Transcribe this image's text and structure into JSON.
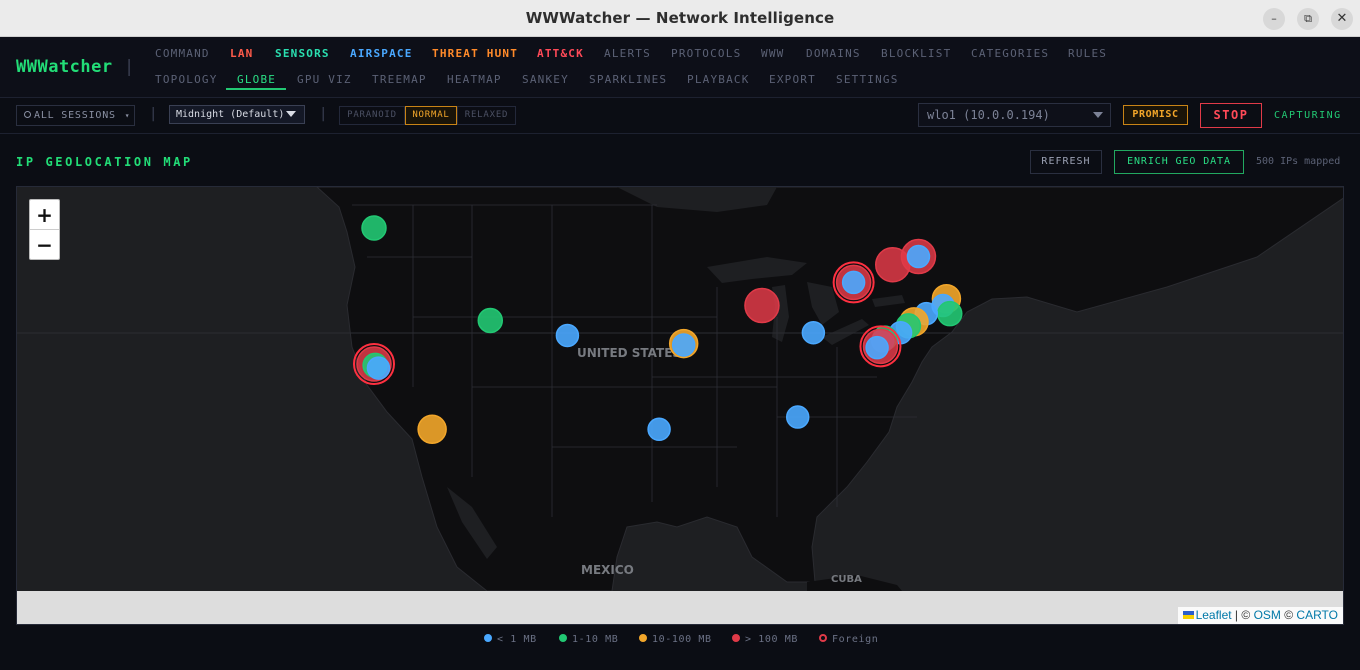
{
  "window": {
    "title": "WWWatcher — Network Intelligence",
    "min_label": "–",
    "max_label": "⧉",
    "close_label": "✕"
  },
  "app": {
    "logo": "WWWatcher",
    "separator": "|"
  },
  "nav": {
    "row1": [
      {
        "label": "COMMAND",
        "color": "#5b6175"
      },
      {
        "label": "LAN",
        "color": "#ff5b4a"
      },
      {
        "label": "SENSORS",
        "color": "#2adfb0"
      },
      {
        "label": "AIRSPACE",
        "color": "#4aa8ff"
      },
      {
        "label": "THREAT HUNT",
        "color": "#ff8a2a"
      },
      {
        "label": "ATT&CK",
        "color": "#ff4a58"
      },
      {
        "label": "ALERTS",
        "color": "#5b6175"
      },
      {
        "label": "PROTOCOLS",
        "color": "#5b6175"
      },
      {
        "label": "WWW",
        "color": "#5b6175"
      },
      {
        "label": "DOMAINS",
        "color": "#5b6175"
      },
      {
        "label": "BLOCKLIST",
        "color": "#5b6175"
      },
      {
        "label": "CATEGORIES",
        "color": "#5b6175"
      },
      {
        "label": "RULES",
        "color": "#5b6175"
      }
    ],
    "row2": [
      {
        "label": "TOPOLOGY"
      },
      {
        "label": "GLOBE",
        "active": true
      },
      {
        "label": "GPU VIZ"
      },
      {
        "label": "TREEMAP"
      },
      {
        "label": "HEATMAP"
      },
      {
        "label": "SANKEY"
      },
      {
        "label": "SPARKLINES"
      },
      {
        "label": "PLAYBACK"
      },
      {
        "label": "EXPORT"
      },
      {
        "label": "SETTINGS"
      }
    ]
  },
  "toolbar": {
    "sessions_label": "ALL SESSIONS",
    "sessions_caret": "▾",
    "separator": "|",
    "theme_value": "Midnight (Default)",
    "sensitivity": [
      "PARANOID",
      "NORMAL",
      "RELAXED"
    ],
    "sensitivity_selected": "NORMAL",
    "interface_value": "wlo1 (10.0.0.194)",
    "promisc_label": "PROMISC",
    "stop_label": "STOP",
    "status_label": "CAPTURING"
  },
  "geo": {
    "title": "IP GEOLOCATION MAP",
    "refresh_label": "REFRESH",
    "enrich_label": "ENRICH GEO DATA",
    "mapped_text": "500 IPs mapped",
    "zoom_in": "+",
    "zoom_out": "−",
    "countries": [
      "UNITED STATES",
      "MEXICO",
      "CUBA"
    ],
    "attribution": {
      "leaflet": "Leaflet",
      "sep1": " | © ",
      "osm": "OSM",
      "sep2": " © ",
      "carto": "CARTO"
    },
    "markers": [
      {
        "lat": 47.6,
        "lon": -122.3,
        "cls": "1-10",
        "foreign": false
      },
      {
        "lat": 44.9,
        "lon": -75.9,
        "cls": ">100",
        "foreign": false
      },
      {
        "lat": 45.5,
        "lon": -73.6,
        "cls": ">100",
        "foreign": false
      },
      {
        "lat": 45.5,
        "lon": -73.6,
        "cls": "<1",
        "foreign": false
      },
      {
        "lat": 43.6,
        "lon": -79.4,
        "cls": ">100",
        "foreign": true
      },
      {
        "lat": 43.6,
        "lon": -79.4,
        "cls": "<1",
        "foreign": false
      },
      {
        "lat": 42.4,
        "lon": -71.1,
        "cls": "10-100",
        "foreign": false
      },
      {
        "lat": 41.9,
        "lon": -71.4,
        "cls": "<1",
        "foreign": false
      },
      {
        "lat": 41.3,
        "lon": -70.8,
        "cls": "1-10",
        "foreign": false
      },
      {
        "lat": 41.3,
        "lon": -72.9,
        "cls": "<1",
        "foreign": false
      },
      {
        "lat": 40.7,
        "lon": -74.0,
        "cls": "10-100",
        "foreign": false
      },
      {
        "lat": 40.4,
        "lon": -74.5,
        "cls": "1-10",
        "foreign": false
      },
      {
        "lat": 39.9,
        "lon": -75.2,
        "cls": "<1",
        "foreign": false
      },
      {
        "lat": 39.5,
        "lon": -76.6,
        "cls": "1-10",
        "foreign": false
      },
      {
        "lat": 39.3,
        "lon": -76.8,
        "cls": "<1",
        "foreign": false
      },
      {
        "lat": 38.9,
        "lon": -77.0,
        "cls": ">100",
        "foreign": true
      },
      {
        "lat": 38.8,
        "lon": -77.3,
        "cls": "<1",
        "foreign": false
      },
      {
        "lat": 39.9,
        "lon": -83.0,
        "cls": "<1",
        "foreign": false
      },
      {
        "lat": 41.9,
        "lon": -87.6,
        "cls": ">100",
        "foreign": false
      },
      {
        "lat": 39.1,
        "lon": -94.6,
        "cls": "10-100",
        "foreign": false
      },
      {
        "lat": 39.0,
        "lon": -94.6,
        "cls": "<1",
        "foreign": false
      },
      {
        "lat": 39.7,
        "lon": -105.0,
        "cls": "<1",
        "foreign": false
      },
      {
        "lat": 40.8,
        "lon": -111.9,
        "cls": "1-10",
        "foreign": false
      },
      {
        "lat": 37.6,
        "lon": -122.3,
        "cls": ">100",
        "foreign": true
      },
      {
        "lat": 37.5,
        "lon": -122.2,
        "cls": "1-10",
        "foreign": false
      },
      {
        "lat": 37.3,
        "lon": -121.9,
        "cls": "<1",
        "foreign": false
      },
      {
        "lat": 32.8,
        "lon": -117.1,
        "cls": "10-100",
        "foreign": false
      },
      {
        "lat": 32.8,
        "lon": -96.8,
        "cls": "<1",
        "foreign": false
      },
      {
        "lat": 33.7,
        "lon": -84.4,
        "cls": "<1",
        "foreign": false
      }
    ]
  },
  "legend": [
    {
      "label": "< 1 MB",
      "color": "#4aa8ff",
      "ring": false
    },
    {
      "label": "1-10 MB",
      "color": "#22c873",
      "ring": false
    },
    {
      "label": "10-100 MB",
      "color": "#f2a62a",
      "ring": false
    },
    {
      "label": "> 100 MB",
      "color": "#e03a48",
      "ring": false
    },
    {
      "label": "Foreign",
      "color": "#e03a48",
      "ring": true
    }
  ]
}
